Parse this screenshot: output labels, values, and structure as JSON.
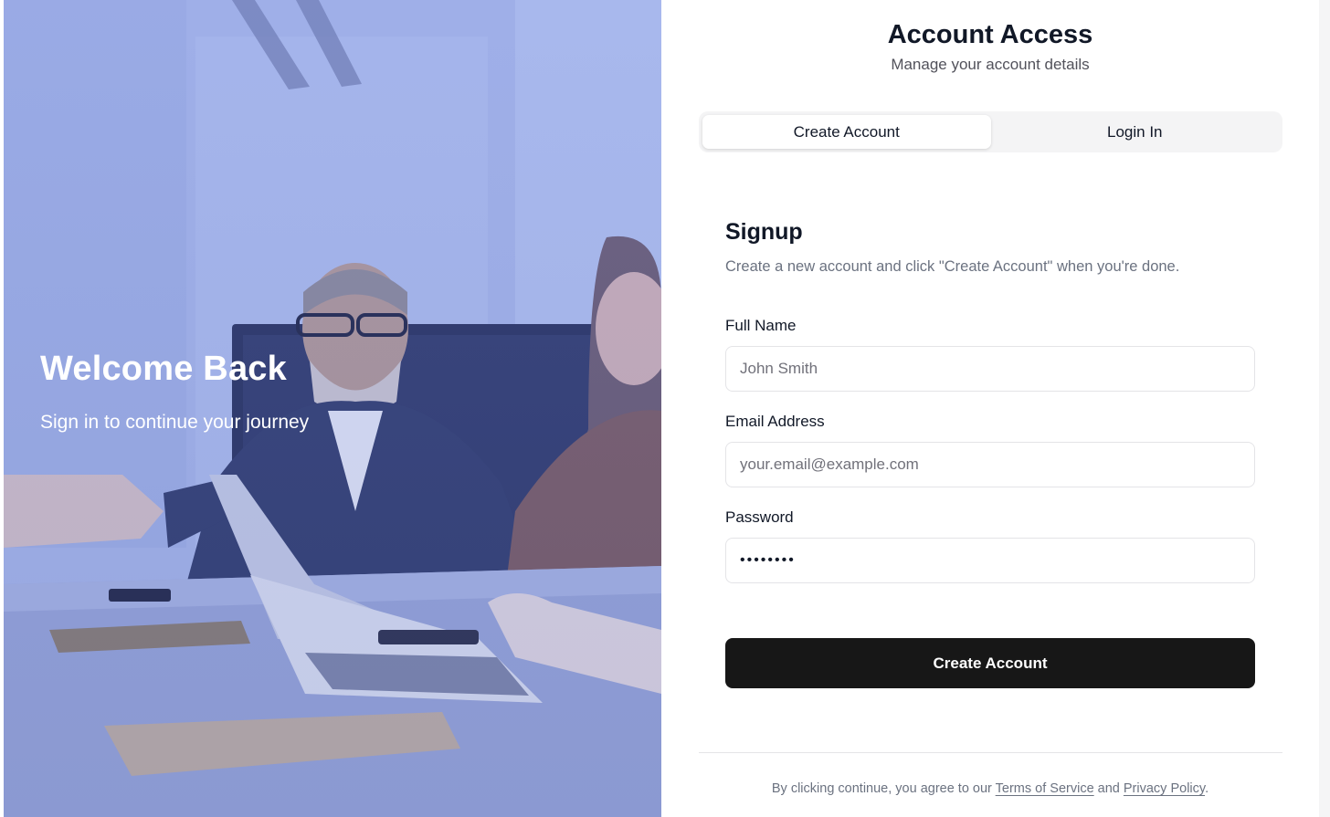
{
  "hero": {
    "title": "Welcome Back",
    "subtitle": "Sign in to continue your journey"
  },
  "header": {
    "title": "Account Access",
    "subtitle": "Manage your account details"
  },
  "tabs": [
    {
      "label": "Create Account",
      "active": true
    },
    {
      "label": "Login In",
      "active": false
    }
  ],
  "form": {
    "title": "Signup",
    "description": "Create a new account and click \"Create Account\" when you're done.",
    "fields": {
      "full_name": {
        "label": "Full Name",
        "placeholder": "John Smith",
        "value": ""
      },
      "email": {
        "label": "Email Address",
        "placeholder": "your.email@example.com",
        "value": ""
      },
      "password": {
        "label": "Password",
        "placeholder": "",
        "value": "••••••••"
      }
    },
    "submit_label": "Create Account"
  },
  "footer": {
    "prefix": "By clicking continue, you agree to our ",
    "terms_label": "Terms of Service",
    "joiner": " and ",
    "privacy_label": "Privacy Policy",
    "suffix": "."
  },
  "colors": {
    "primary_button": "#171717",
    "hero_tint": "#8596cf",
    "tab_track": "#f4f4f5"
  }
}
